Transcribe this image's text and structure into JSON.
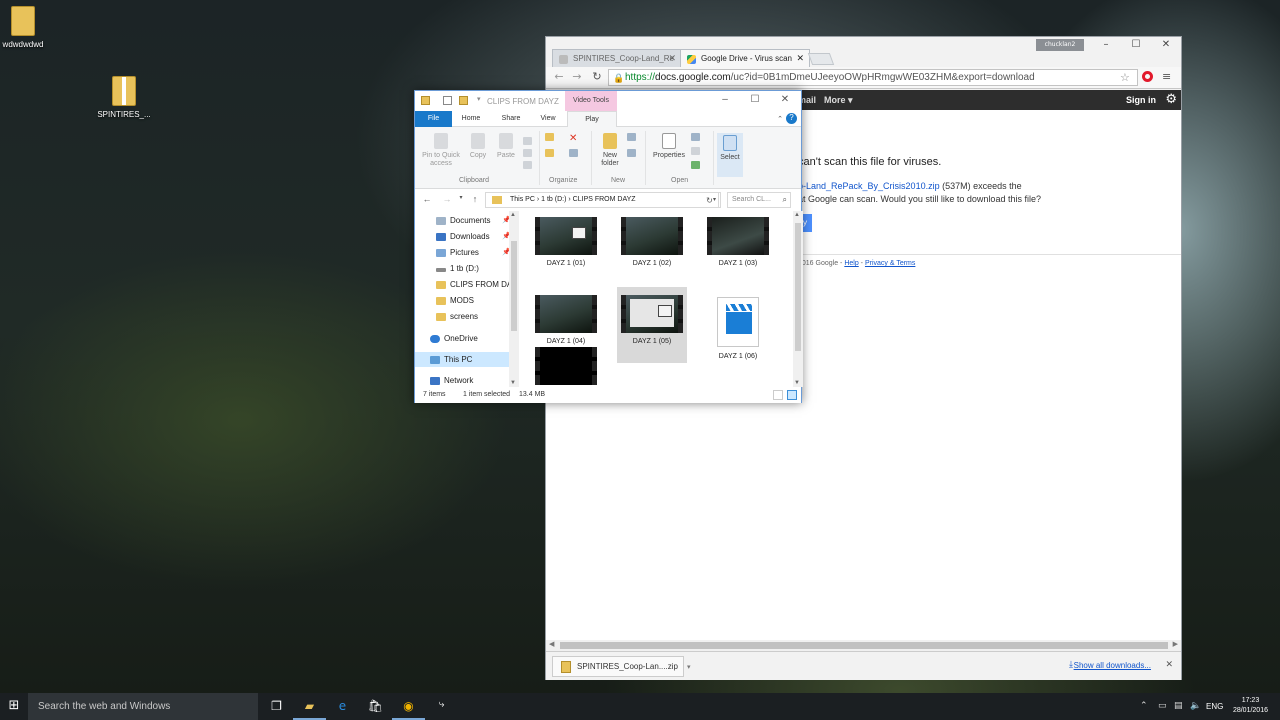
{
  "desktop": {
    "icons": [
      {
        "label": "wdwdwdwd",
        "icon": "folder-icon"
      },
      {
        "label": "SPINTIRES_...",
        "icon": "zip-folder-icon"
      }
    ]
  },
  "chrome": {
    "user": "chucklan2",
    "tabs": [
      {
        "label": "SPINTIRES_Coop-Land_Re",
        "active": false
      },
      {
        "label": "Google Drive - Virus scan",
        "active": true
      }
    ],
    "url_scheme": "https://",
    "url_host": "docs.google.com",
    "url_path": "/uc?id=0B1mDmeUJeeyoOWpHRmgwWE03ZHM&export=download",
    "google_bar": {
      "gmail": "mail",
      "more": "More ▾",
      "sign_in": "Sign in"
    },
    "page": {
      "headline": "can't scan this file for viruses.",
      "message_file": "p-Land_RePack_By_Crisis2010.zip",
      "message_size": " (537M) exceeds the",
      "message_line2": "at Google can scan. Would you still like to download this file?",
      "button": "y",
      "footer_copyright": "2016 Google - ",
      "footer_help": "Help",
      "footer_sep": " - ",
      "footer_privacy": "Privacy & Terms"
    },
    "download_shelf": {
      "item": "SPINTIRES_Coop-Lan....zip",
      "show_all": "Show all downloads..."
    },
    "accent_color": "#1155cc"
  },
  "explorer": {
    "title": "CLIPS FROM DAYZ",
    "context_tab": "Video Tools",
    "tabs": [
      "File",
      "Home",
      "Share",
      "View",
      "Play"
    ],
    "ribbon": {
      "pin_label": "Pin to Quick access",
      "copy": "Copy",
      "paste": "Paste",
      "new_folder": "New folder",
      "properties": "Properties",
      "select": "Select",
      "groups": [
        "Clipboard",
        "Organize",
        "New",
        "Open"
      ]
    },
    "breadcrumb": [
      "This PC",
      "1 tb (D:)",
      "CLIPS FROM DAYZ"
    ],
    "search_placeholder": "Search CL...",
    "nav": [
      {
        "label": "Documents",
        "icon": "documents-icon",
        "pinned": true
      },
      {
        "label": "Downloads",
        "icon": "downloads-icon",
        "pinned": true
      },
      {
        "label": "Pictures",
        "icon": "pictures-icon",
        "pinned": true
      },
      {
        "label": "1 tb (D:)",
        "icon": "drive-icon",
        "pinned": false
      },
      {
        "label": "CLIPS FROM DAYZ",
        "icon": "folder-icon",
        "pinned": false
      },
      {
        "label": "MODS",
        "icon": "folder-icon",
        "pinned": false
      },
      {
        "label": "screens",
        "icon": "folder-icon",
        "pinned": false
      },
      {
        "label": "OneDrive",
        "icon": "onedrive-icon",
        "pinned": false
      },
      {
        "label": "This PC",
        "icon": "pc-icon",
        "pinned": false
      },
      {
        "label": "Network",
        "icon": "network-icon",
        "pinned": false
      }
    ],
    "files": [
      {
        "label": "DAYZ 1 (01)",
        "thumb": "desktop"
      },
      {
        "label": "DAYZ 1 (02)",
        "thumb": "scene"
      },
      {
        "label": "DAYZ 1 (03)",
        "thumb": "scene"
      },
      {
        "label": "DAYZ 1 (04)",
        "thumb": "scene"
      },
      {
        "label": "DAYZ 1 (05)",
        "thumb": "desktop",
        "selected": true
      },
      {
        "label": "DAYZ 1 (06)",
        "thumb": "clapper"
      },
      {
        "label": "",
        "thumb": "black"
      }
    ],
    "status": {
      "count": "7 items",
      "selected": "1 item selected",
      "size": "13.4 MB"
    }
  },
  "taskbar": {
    "search_placeholder": "Search the web and Windows",
    "lang": "ENG",
    "time": "17:23",
    "date": "28/01/2016"
  }
}
